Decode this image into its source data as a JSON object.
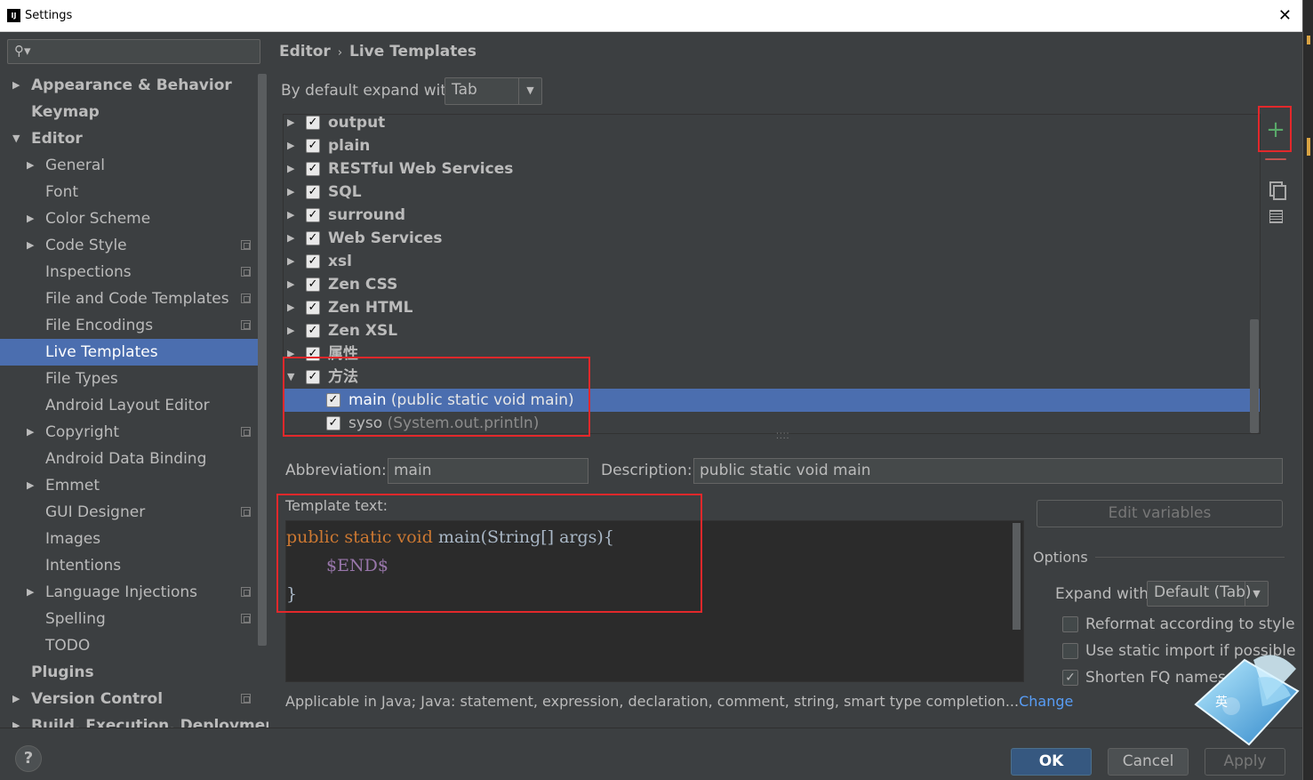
{
  "window": {
    "title": "Settings",
    "app_icon": "IJ"
  },
  "sidebar": {
    "search_placeholder": "",
    "items": [
      {
        "label": "Appearance & Behavior",
        "level": 0,
        "arrow": "▶",
        "bold": true
      },
      {
        "label": "Keymap",
        "level": 0,
        "arrow": "",
        "bold": true
      },
      {
        "label": "Editor",
        "level": 0,
        "arrow": "▼",
        "bold": true
      },
      {
        "label": "General",
        "level": 1,
        "arrow": "▶"
      },
      {
        "label": "Font",
        "level": 1,
        "arrow": ""
      },
      {
        "label": "Color Scheme",
        "level": 1,
        "arrow": "▶"
      },
      {
        "label": "Code Style",
        "level": 1,
        "arrow": "▶",
        "project": true
      },
      {
        "label": "Inspections",
        "level": 1,
        "arrow": "",
        "project": true
      },
      {
        "label": "File and Code Templates",
        "level": 1,
        "arrow": "",
        "project": true
      },
      {
        "label": "File Encodings",
        "level": 1,
        "arrow": "",
        "project": true
      },
      {
        "label": "Live Templates",
        "level": 1,
        "arrow": "",
        "selected": true
      },
      {
        "label": "File Types",
        "level": 1,
        "arrow": ""
      },
      {
        "label": "Android Layout Editor",
        "level": 1,
        "arrow": ""
      },
      {
        "label": "Copyright",
        "level": 1,
        "arrow": "▶",
        "project": true
      },
      {
        "label": "Android Data Binding",
        "level": 1,
        "arrow": ""
      },
      {
        "label": "Emmet",
        "level": 1,
        "arrow": "▶"
      },
      {
        "label": "GUI Designer",
        "level": 1,
        "arrow": "",
        "project": true
      },
      {
        "label": "Images",
        "level": 1,
        "arrow": ""
      },
      {
        "label": "Intentions",
        "level": 1,
        "arrow": ""
      },
      {
        "label": "Language Injections",
        "level": 1,
        "arrow": "▶",
        "project": true
      },
      {
        "label": "Spelling",
        "level": 1,
        "arrow": "",
        "project": true
      },
      {
        "label": "TODO",
        "level": 1,
        "arrow": ""
      },
      {
        "label": "Plugins",
        "level": 0,
        "arrow": "",
        "bold": true
      },
      {
        "label": "Version Control",
        "level": 0,
        "arrow": "▶",
        "bold": true,
        "project": true
      },
      {
        "label": "Build, Execution, Deployment",
        "level": 0,
        "arrow": "▶",
        "bold": true
      }
    ]
  },
  "breadcrumb": {
    "parent": "Editor",
    "separator": "›",
    "current": "Live Templates"
  },
  "expand": {
    "label": "By default expand with",
    "value": "Tab"
  },
  "templates": [
    {
      "name": "output",
      "arrow": "▶",
      "checked": true,
      "group": true
    },
    {
      "name": "plain",
      "arrow": "▶",
      "checked": true,
      "group": true
    },
    {
      "name": "RESTful Web Services",
      "arrow": "▶",
      "checked": true,
      "group": true
    },
    {
      "name": "SQL",
      "arrow": "▶",
      "checked": true,
      "group": true
    },
    {
      "name": "surround",
      "arrow": "▶",
      "checked": true,
      "group": true
    },
    {
      "name": "Web Services",
      "arrow": "▶",
      "checked": true,
      "group": true
    },
    {
      "name": "xsl",
      "arrow": "▶",
      "checked": true,
      "group": true
    },
    {
      "name": "Zen CSS",
      "arrow": "▶",
      "checked": true,
      "group": true
    },
    {
      "name": "Zen HTML",
      "arrow": "▶",
      "checked": true,
      "group": true
    },
    {
      "name": "Zen XSL",
      "arrow": "▶",
      "checked": true,
      "group": true
    },
    {
      "name": "属性",
      "arrow": "▶",
      "checked": true,
      "group": true
    },
    {
      "name": "方法",
      "arrow": "▼",
      "checked": true,
      "group": true
    },
    {
      "name": "main",
      "desc": "(public static void main)",
      "checked": true,
      "group": false,
      "selected": true
    },
    {
      "name": "syso",
      "desc": "(System.out.println)",
      "checked": true,
      "group": false
    }
  ],
  "toolbar": {
    "add": "+",
    "remove": "—"
  },
  "abbreviation": {
    "label": "Abbreviation:",
    "value": "main"
  },
  "description": {
    "label": "Description:",
    "value": "public static void main"
  },
  "template_text": {
    "label": "Template text:",
    "line1_kw": "public static void",
    "line1_rest": " main(String[] args){",
    "line2": "$END$",
    "line3": "}"
  },
  "edit_variables": "Edit variables",
  "options": {
    "title": "Options",
    "expand_label": "Expand with",
    "expand_value": "Default (Tab)",
    "reformat": {
      "label": "Reformat according to style",
      "checked": false
    },
    "static_import": {
      "label": "Use static import if possible",
      "checked": false
    },
    "shorten_fq": {
      "label": "Shorten FQ names",
      "checked": true
    }
  },
  "applicable": {
    "text": "Applicable in Java; Java: statement, expression, declaration, comment, string, smart type completion...",
    "link": "Change"
  },
  "buttons": {
    "ok": "OK",
    "cancel": "Cancel",
    "apply": "Apply"
  },
  "help": "?",
  "ime_badge": {
    "label": "英"
  }
}
